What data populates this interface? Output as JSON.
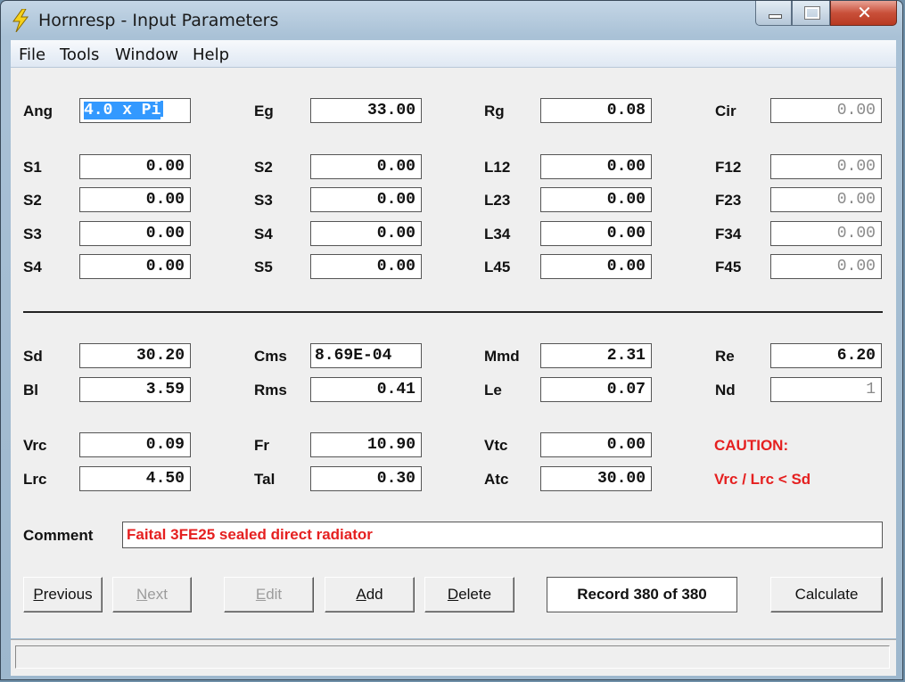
{
  "window": {
    "title": "Hornresp - Input Parameters",
    "icon": "lightning-bolt-icon",
    "close_glyph": "✕"
  },
  "menu": [
    "File",
    "Tools",
    "Window",
    "Help"
  ],
  "row0": {
    "ang": {
      "label": "Ang",
      "value": "4.0 x Pi"
    },
    "eg": {
      "label": "Eg",
      "value": "33.00"
    },
    "rg": {
      "label": "Rg",
      "value": "0.08"
    },
    "cir": {
      "label": "Cir",
      "value": "0.00"
    }
  },
  "segments": [
    {
      "c1": {
        "label": "S1",
        "value": "0.00"
      },
      "c2": {
        "label": "S2",
        "value": "0.00"
      },
      "c3": {
        "label": "L12",
        "value": "0.00"
      },
      "c4": {
        "label": "F12",
        "value": "0.00"
      }
    },
    {
      "c1": {
        "label": "S2",
        "value": "0.00"
      },
      "c2": {
        "label": "S3",
        "value": "0.00"
      },
      "c3": {
        "label": "L23",
        "value": "0.00"
      },
      "c4": {
        "label": "F23",
        "value": "0.00"
      }
    },
    {
      "c1": {
        "label": "S3",
        "value": "0.00"
      },
      "c2": {
        "label": "S4",
        "value": "0.00"
      },
      "c3": {
        "label": "L34",
        "value": "0.00"
      },
      "c4": {
        "label": "F34",
        "value": "0.00"
      }
    },
    {
      "c1": {
        "label": "S4",
        "value": "0.00"
      },
      "c2": {
        "label": "S5",
        "value": "0.00"
      },
      "c3": {
        "label": "L45",
        "value": "0.00"
      },
      "c4": {
        "label": "F45",
        "value": "0.00"
      }
    }
  ],
  "driver": [
    {
      "c1": {
        "label": "Sd",
        "value": "30.20"
      },
      "c2": {
        "label": "Cms",
        "value": "8.69E-04"
      },
      "c3": {
        "label": "Mmd",
        "value": "2.31"
      },
      "c4": {
        "label": "Re",
        "value": "6.20"
      }
    },
    {
      "c1": {
        "label": "Bl",
        "value": "3.59"
      },
      "c2": {
        "label": "Rms",
        "value": "0.41"
      },
      "c3": {
        "label": "Le",
        "value": "0.07"
      },
      "c4": {
        "label": "Nd",
        "value": "1"
      }
    }
  ],
  "chamber": [
    {
      "c1": {
        "label": "Vrc",
        "value": "0.09"
      },
      "c2": {
        "label": "Fr",
        "value": "10.90"
      },
      "c3": {
        "label": "Vtc",
        "value": "0.00"
      }
    },
    {
      "c1": {
        "label": "Lrc",
        "value": "4.50"
      },
      "c2": {
        "label": "Tal",
        "value": "0.30"
      },
      "c3": {
        "label": "Atc",
        "value": "30.00"
      }
    }
  ],
  "caution": {
    "title": "CAUTION:",
    "message": "Vrc / Lrc < Sd",
    "color": "#e52020"
  },
  "comment": {
    "label": "Comment",
    "value": "Faital 3FE25 sealed direct radiator"
  },
  "buttons": {
    "previous": {
      "label": "Previous",
      "enabled": true
    },
    "next": {
      "label": "Next",
      "enabled": false
    },
    "edit": {
      "label": "Edit",
      "enabled": false
    },
    "add": {
      "label": "Add",
      "enabled": true
    },
    "delete": {
      "label": "Delete",
      "enabled": true
    },
    "calculate": {
      "label": "Calculate",
      "enabled": true
    }
  },
  "record": "Record 380 of 380",
  "status": ""
}
